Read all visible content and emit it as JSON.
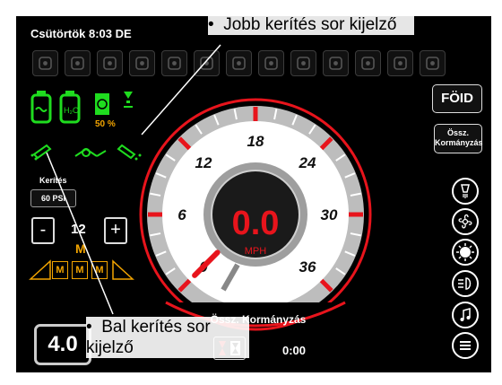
{
  "header": {
    "datetime": "Csütörtök 8:03 DE"
  },
  "top_icons": [
    {
      "name": "parking-brake-icon"
    },
    {
      "name": "warning-triangle-icon"
    },
    {
      "name": "stop-icon"
    },
    {
      "name": "water-tank-icon"
    },
    {
      "name": "spray-boom-icon"
    },
    {
      "name": "boom-left-warning-icon"
    },
    {
      "name": "boom-spray-icon"
    },
    {
      "name": "boom-fault-icon"
    },
    {
      "name": "tank-level-icon"
    },
    {
      "name": "pump-icon"
    },
    {
      "name": "engine-icon"
    },
    {
      "name": "hose-icon"
    },
    {
      "name": "filter-icon"
    }
  ],
  "status": {
    "fan_percent": "50 %",
    "fence_label": "Kerítés",
    "psi": "60 PSI",
    "rate_value": "12",
    "rate_mode": "M",
    "section_m1": "M",
    "section_m2": "M",
    "section_m3": "M"
  },
  "controls": {
    "minus": "-",
    "plus": "+"
  },
  "bottom_left": {
    "speed_box": "4.0"
  },
  "gauge": {
    "speed_value": "0.0",
    "unit": "MPH",
    "arc_label": "Össz. Kormányzás",
    "ticks": [
      {
        "label": "0",
        "value": 0
      },
      {
        "label": "6",
        "value": 6
      },
      {
        "label": "12",
        "value": 12
      },
      {
        "label": "18",
        "value": 18
      },
      {
        "label": "24",
        "value": 24
      },
      {
        "label": "30",
        "value": 30
      },
      {
        "label": "36",
        "value": 36
      }
    ],
    "needle_value": 0,
    "max": 36
  },
  "right_panel": {
    "button1": "FÖID",
    "button2_line1": "Össz.",
    "button2_line2": "Kormányzás"
  },
  "bottom": {
    "timer": "0:00"
  },
  "callouts": {
    "right_fence": "Jobb kerítés sor kijelző",
    "right_fence_bullet": "•",
    "left_fence": "Bal kerítés sor kijelző",
    "left_fence_bullet": "•"
  },
  "colors": {
    "accent_red": "#e8141c",
    "green": "#1fdc1f",
    "amber": "#f2a400"
  }
}
